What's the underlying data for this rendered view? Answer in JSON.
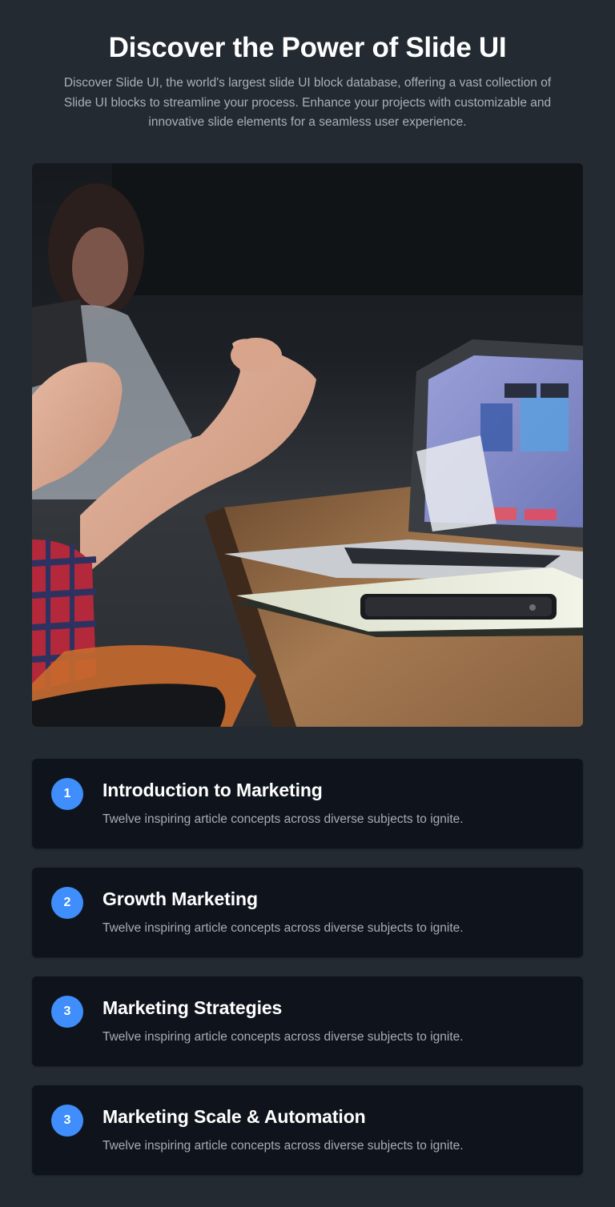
{
  "header": {
    "title": "Discover the Power of Slide UI",
    "description": "Discover Slide UI, the world's largest slide UI block database, offering a vast collection of Slide UI blocks to streamline your process. Enhance your projects with customizable and innovative slide elements for a seamless user experience."
  },
  "colors": {
    "background": "#232a31",
    "card_background": "#0f141c",
    "accent": "#3f8efc",
    "muted_text": "#a9b0b9"
  },
  "hero_image": {
    "icon": "photo-meeting-laptop-hands"
  },
  "items": [
    {
      "number": "1",
      "title": "Introduction to Marketing",
      "description": "Twelve inspiring article concepts across diverse subjects to ignite."
    },
    {
      "number": "2",
      "title": "Growth Marketing",
      "description": "Twelve inspiring article concepts across diverse subjects to ignite."
    },
    {
      "number": "3",
      "title": "Marketing Strategies",
      "description": "Twelve inspiring article concepts across diverse subjects to ignite."
    },
    {
      "number": "3",
      "title": "Marketing Scale & Automation",
      "description": "Twelve inspiring article concepts across diverse subjects to ignite."
    }
  ]
}
